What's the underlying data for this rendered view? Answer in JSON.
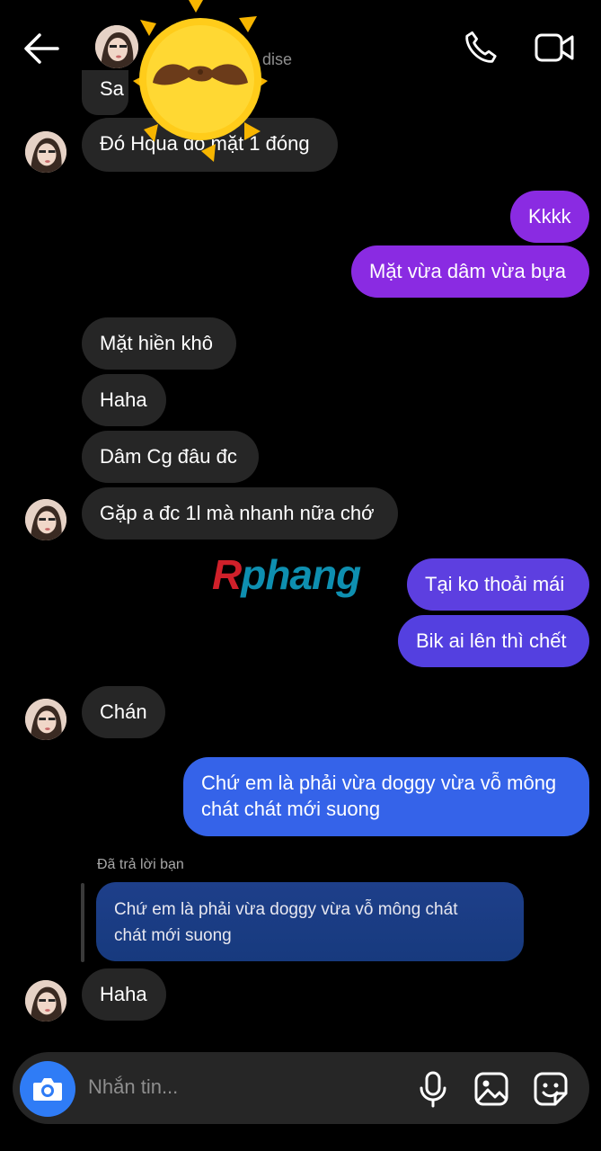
{
  "header": {
    "contact_name_partial": "dise",
    "back_icon": "arrow-left-icon",
    "call_icon": "phone-icon",
    "video_icon": "video-camera-icon"
  },
  "messages": [
    {
      "side": "in",
      "text": "Sa"
    },
    {
      "side": "in",
      "text": "Đó Hqua đó mặt 1 đóng"
    },
    {
      "side": "out",
      "text": "Kkkk"
    },
    {
      "side": "out",
      "text": "Mặt vừa dâm vừa bựa"
    },
    {
      "side": "in",
      "text": "Mặt hiền khô"
    },
    {
      "side": "in",
      "text": "Haha"
    },
    {
      "side": "in",
      "text": "Dâm Cg đâu đc"
    },
    {
      "side": "in",
      "text": "Gặp a đc 1l mà nhanh nữa chớ"
    },
    {
      "side": "out",
      "text": "Tại ko thoải mái"
    },
    {
      "side": "out",
      "text": "Bik ai lên thì chết"
    },
    {
      "side": "in",
      "text": "Chán"
    },
    {
      "side": "out",
      "text": "Chứ em là phải vừa doggy vừa vỗ mông chất chất mới suong",
      "lines": [
        "Chứ em là phải vừa doggy vừa vỗ mông",
        "chát chát mới suong"
      ]
    },
    {
      "side": "in",
      "text": "Haha"
    }
  ],
  "reply": {
    "label": "Đã trả lời bạn",
    "quoted_lines": [
      "Chứ em là phải vừa doggy vừa vỗ mông chát",
      "chát mới suong"
    ]
  },
  "composer": {
    "placeholder": "Nhắn tin...",
    "camera_icon": "camera-icon",
    "mic_icon": "microphone-icon",
    "gallery_icon": "image-icon",
    "sticker_icon": "sticker-icon"
  },
  "watermark": {
    "text_a": "R",
    "text_b": "phang"
  },
  "colors": {
    "incoming_bubble": "#262626",
    "outgoing_purple": "#8a2be2",
    "outgoing_violet": "#5b3fe0",
    "outgoing_blue": "#3563e9",
    "camera_button": "#2f7cf6"
  }
}
